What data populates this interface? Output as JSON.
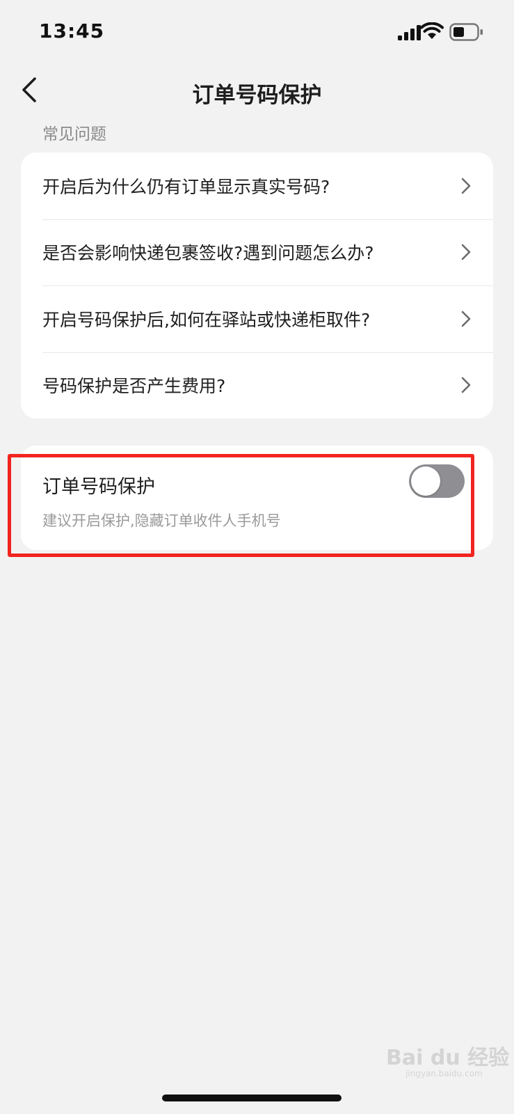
{
  "status_bar": {
    "time": "13:45",
    "icons": [
      "cellular-signal-icon",
      "wifi-icon",
      "battery-icon"
    ]
  },
  "nav": {
    "title": "订单号码保护",
    "back_icon": "chevron-left-icon"
  },
  "faq": {
    "section_label": "常见问题",
    "items": [
      {
        "label": "开启后为什么仍有订单显示真实号码?"
      },
      {
        "label": "是否会影响快递包裹签收?遇到问题怎么办?"
      },
      {
        "label": "开启号码保护后,如何在驿站或快递柜取件?"
      },
      {
        "label": "号码保护是否产生费用?"
      }
    ],
    "item_icon": "chevron-right-icon"
  },
  "protection": {
    "title": "订单号码保护",
    "description": "建议开启保护,隐藏订单收件人手机号",
    "enabled": false
  },
  "watermark": {
    "text": "Bai du 经验",
    "subtext": "jingyan.baidu.com"
  },
  "colors": {
    "background": "#f2f2f2",
    "card": "#ffffff",
    "switch_off": "#8e8e93",
    "highlight": "#f2241f",
    "secondary_text": "#9a9a9a"
  }
}
